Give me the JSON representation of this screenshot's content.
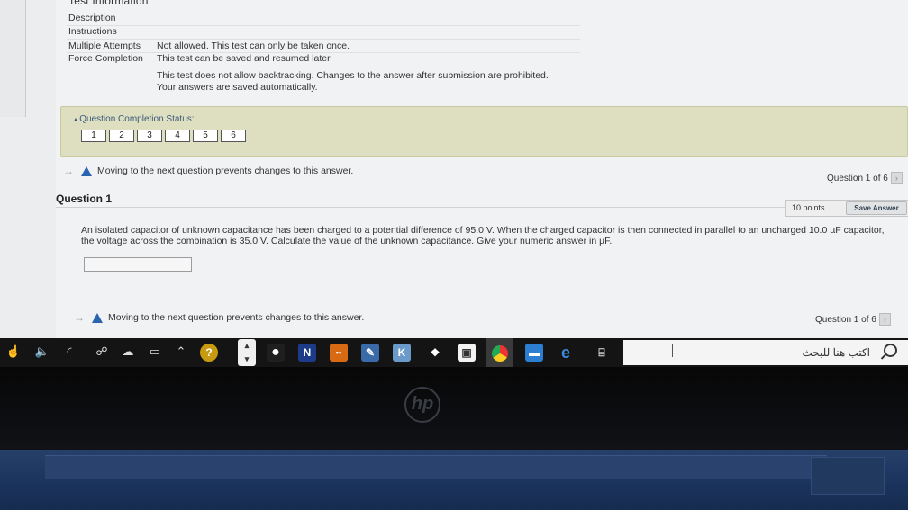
{
  "test_info": {
    "title": "Test Information",
    "rows": [
      {
        "label": "Description",
        "value": ""
      },
      {
        "label": "Instructions",
        "value": ""
      },
      {
        "label": "Multiple Attempts",
        "value": "Not allowed. This test can only be taken once."
      },
      {
        "label": "Force Completion",
        "value": "This test can be saved and resumed later."
      },
      {
        "label": "",
        "value": "This test does not allow backtracking. Changes to the answer after submission are prohibited."
      },
      {
        "label": "",
        "value": "Your answers are saved automatically."
      }
    ]
  },
  "completion_status": {
    "title": "Question Completion Status:",
    "cells": [
      "1",
      "2",
      "3",
      "4",
      "5",
      "6"
    ]
  },
  "warning_text": "Moving to the next question prevents changes to this answer.",
  "question_counter": "Question 1 of 6",
  "question": {
    "title": "Question 1",
    "points": "10 points",
    "save_label": "Save Answer",
    "text": "An isolated capacitor of unknown capacitance has been charged to a potential difference of 95.0 V. When the charged capacitor is then connected in parallel to an uncharged 10.0 µF capacitor, the voltage across the combination is 35.0 V. Calculate the value of the unknown capacitance. Give your numeric answer in µF.",
    "answer_value": ""
  },
  "taskbar": {
    "search_text": "اكتب هنا للبحث",
    "tray_icons": [
      "hand-pointer-icon",
      "volume-icon",
      "wifi-icon",
      "network-icon",
      "cloud-icon",
      "battery-icon",
      "chevron-up-icon"
    ],
    "apps": [
      "help-icon",
      "task-view-icon",
      "edge-icon",
      "onenote-icon",
      "media-icon",
      "paint-icon",
      "k-app-icon",
      "dropbox-icon",
      "store-icon",
      "chrome-icon",
      "files-icon",
      "ie-icon",
      "calculator-icon"
    ]
  },
  "brand": "hp"
}
